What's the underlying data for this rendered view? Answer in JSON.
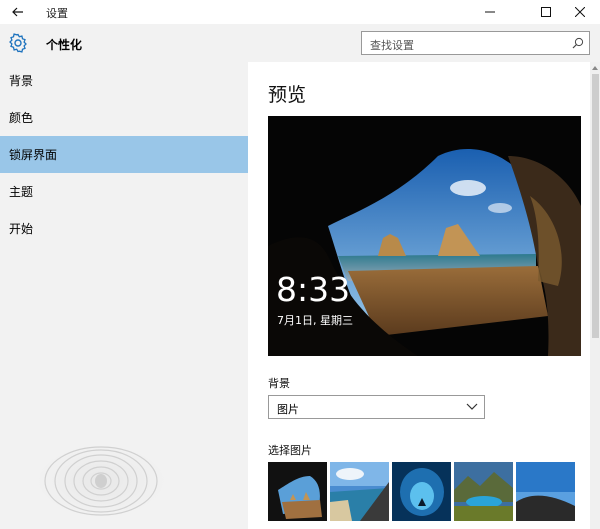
{
  "window": {
    "title": "设置",
    "back_icon": "back-arrow-icon",
    "min_icon": "minimize-icon",
    "max_icon": "maximize-icon",
    "close_icon": "close-icon"
  },
  "header": {
    "icon": "gear-icon",
    "title": "个性化",
    "search_placeholder": "查找设置",
    "search_icon": "search-icon"
  },
  "sidebar": {
    "items": [
      {
        "label": "背景",
        "active": false
      },
      {
        "label": "颜色",
        "active": false
      },
      {
        "label": "锁屏界面",
        "active": true
      },
      {
        "label": "主题",
        "active": false
      },
      {
        "label": "开始",
        "active": false
      }
    ],
    "active_color": "#99c6e8"
  },
  "main": {
    "preview_title": "预览",
    "lock_time": "8:33",
    "lock_date": "7月1日, 星期三",
    "background_label": "背景",
    "background_value": "图片",
    "choose_label": "选择图片"
  }
}
